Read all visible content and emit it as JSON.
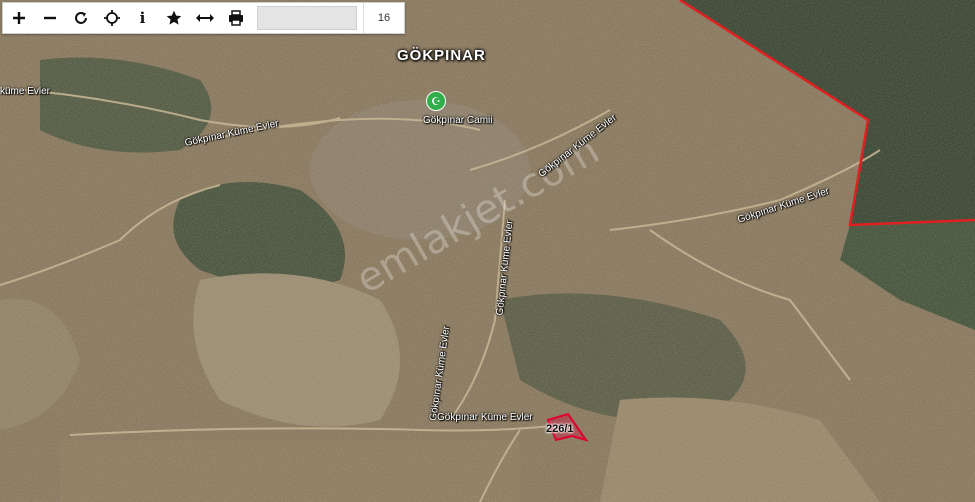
{
  "toolbar": {
    "buttons": [
      {
        "name": "zoom-in-button",
        "icon": "plus-icon",
        "glyph": "+"
      },
      {
        "name": "zoom-out-button",
        "icon": "minus-icon",
        "glyph": "−"
      },
      {
        "name": "refresh-button",
        "icon": "refresh-icon",
        "glyph": "⟳"
      },
      {
        "name": "locate-button",
        "icon": "crosshair-icon",
        "glyph": "⌖"
      },
      {
        "name": "info-button",
        "icon": "info-icon",
        "glyph": "i"
      },
      {
        "name": "favorite-button",
        "icon": "star-icon",
        "glyph": "★"
      },
      {
        "name": "measure-button",
        "icon": "arrows-horizontal-icon",
        "glyph": "↔"
      },
      {
        "name": "print-button",
        "icon": "printer-icon",
        "glyph": "⎙"
      }
    ],
    "search_value": "",
    "zoom_level": "16"
  },
  "map": {
    "town_label": "GÖKPINAR",
    "mosque_label": "Gökpınar Camii",
    "mosque_icon": "mosque-crescent-icon",
    "roads": {
      "west": "Gökpınar Küme Evler",
      "diag": "Gökpınar Küme Evler",
      "vertical": "Gökpınar Küme Evler",
      "east": "Gökpınar Küme Evler",
      "south": "Gökpınar Küme Evler",
      "edge": "küme Evler"
    },
    "parcel_label": "226/1",
    "watermark": "emlakjet.com",
    "colors": {
      "boundary": "#e02020",
      "parcel_fill": "#c0304a",
      "parcel_stroke": "#e00030",
      "mosque_pin": "#2fae4a"
    }
  }
}
